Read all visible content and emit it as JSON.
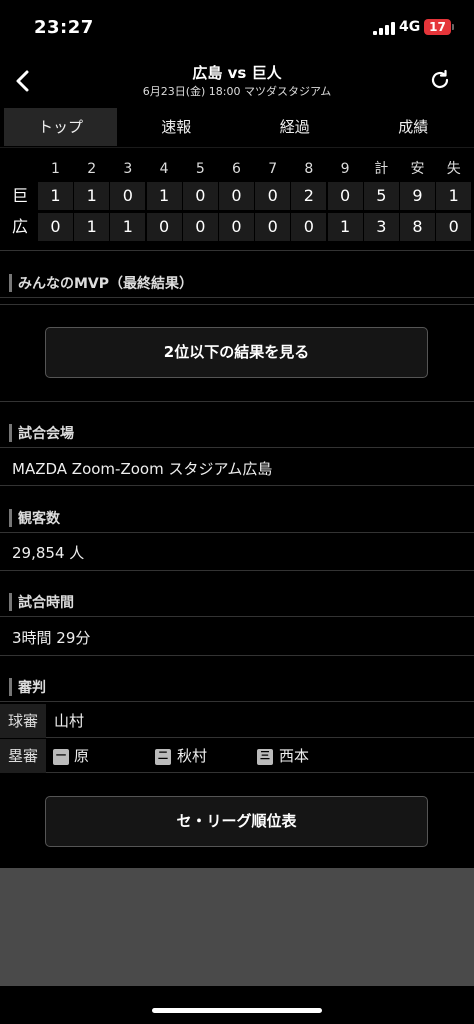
{
  "status": {
    "time": "23:27",
    "network": "4G",
    "battery": "17"
  },
  "header": {
    "title": "広島 vs 巨人",
    "subtitle": "6月23日(金) 18:00 マツダスタジアム"
  },
  "tabs": [
    {
      "label": "トップ",
      "active": true
    },
    {
      "label": "速報",
      "active": false
    },
    {
      "label": "経過",
      "active": false
    },
    {
      "label": "成績",
      "active": false
    }
  ],
  "scoreboard": {
    "headers": [
      "1",
      "2",
      "3",
      "4",
      "5",
      "6",
      "7",
      "8",
      "9",
      "計",
      "安",
      "失"
    ],
    "teams": [
      {
        "name": "巨",
        "scores": [
          "1",
          "1",
          "0",
          "1",
          "0",
          "0",
          "0",
          "2",
          "0",
          "5",
          "9",
          "1"
        ]
      },
      {
        "name": "広",
        "scores": [
          "0",
          "1",
          "1",
          "0",
          "0",
          "0",
          "0",
          "0",
          "1",
          "3",
          "8",
          "0"
        ]
      }
    ]
  },
  "mvp": {
    "heading": "みんなのMVP（最終結果）",
    "button_label": "2位以下の結果を見る"
  },
  "venue": {
    "heading": "試合会場",
    "value": "MAZDA Zoom-Zoom スタジアム広島"
  },
  "attendance": {
    "heading": "観客数",
    "value": "29,854 人"
  },
  "duration": {
    "heading": "試合時間",
    "value": "3時間 29分"
  },
  "umpires": {
    "heading": "審判",
    "plate_role": "球審",
    "plate_name": "山村",
    "base_role": "塁審",
    "bases": [
      {
        "badge": "一",
        "name": "原"
      },
      {
        "badge": "二",
        "name": "秋村"
      },
      {
        "badge": "三",
        "name": "西本"
      }
    ]
  },
  "standings_button": "セ・リーグ順位表"
}
